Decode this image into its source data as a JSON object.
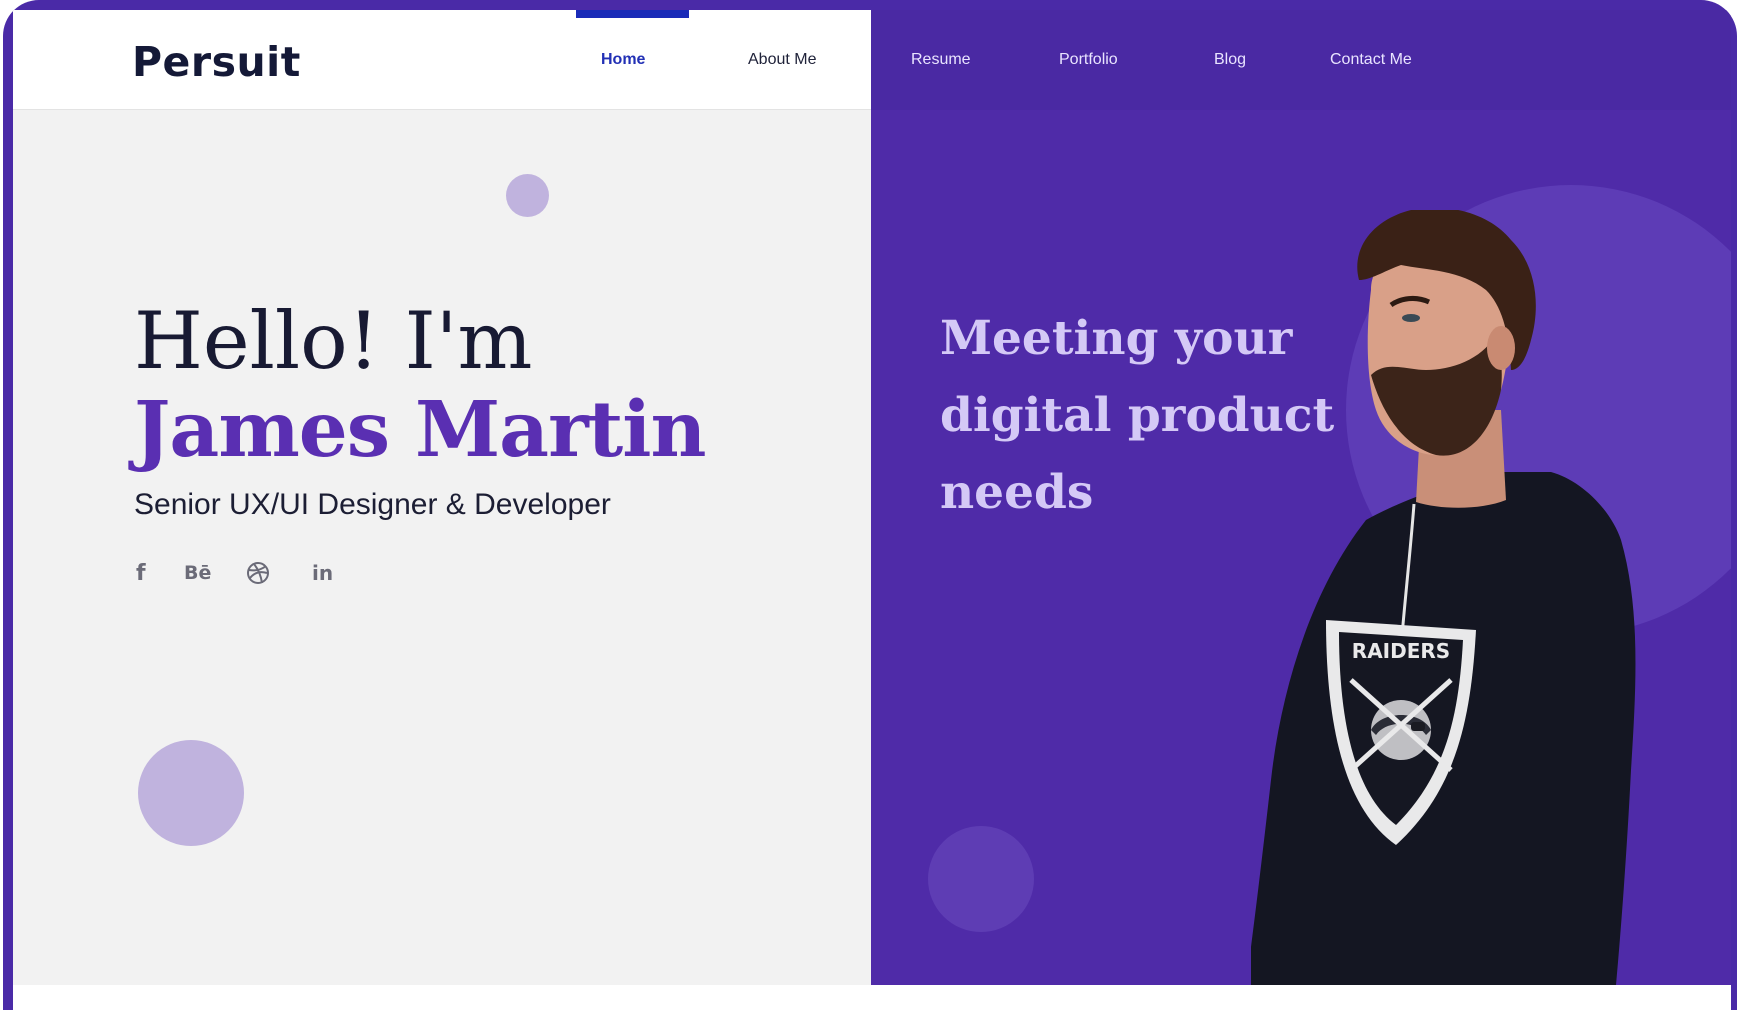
{
  "brand": {
    "logo_text": "Persuit"
  },
  "nav": {
    "items": [
      {
        "label": "Home",
        "active": true
      },
      {
        "label": "About Me",
        "active": false
      },
      {
        "label": "Resume",
        "active": false
      },
      {
        "label": "Portfolio",
        "active": false
      },
      {
        "label": "Blog",
        "active": false
      },
      {
        "label": "Contact Me",
        "active": false
      }
    ]
  },
  "hero": {
    "greeting": "Hello! I'm",
    "name": "James Martin",
    "role": "Senior UX/UI Designer & Developer",
    "tagline": "Meeting your digital product needs",
    "social": [
      {
        "icon": "facebook-icon",
        "glyph": "f"
      },
      {
        "icon": "behance-icon",
        "glyph": "Bē"
      },
      {
        "icon": "dribbble-icon",
        "glyph": ""
      },
      {
        "icon": "linkedin-icon",
        "glyph": "in"
      }
    ],
    "shirt_text": "RAIDERS"
  },
  "colors": {
    "accent": "#4f2ba8",
    "nav_active": "#2230b5",
    "name_purple": "#5a2fb2",
    "light_panel": "#f2f2f2",
    "decor_circle": "#c0b3de"
  }
}
